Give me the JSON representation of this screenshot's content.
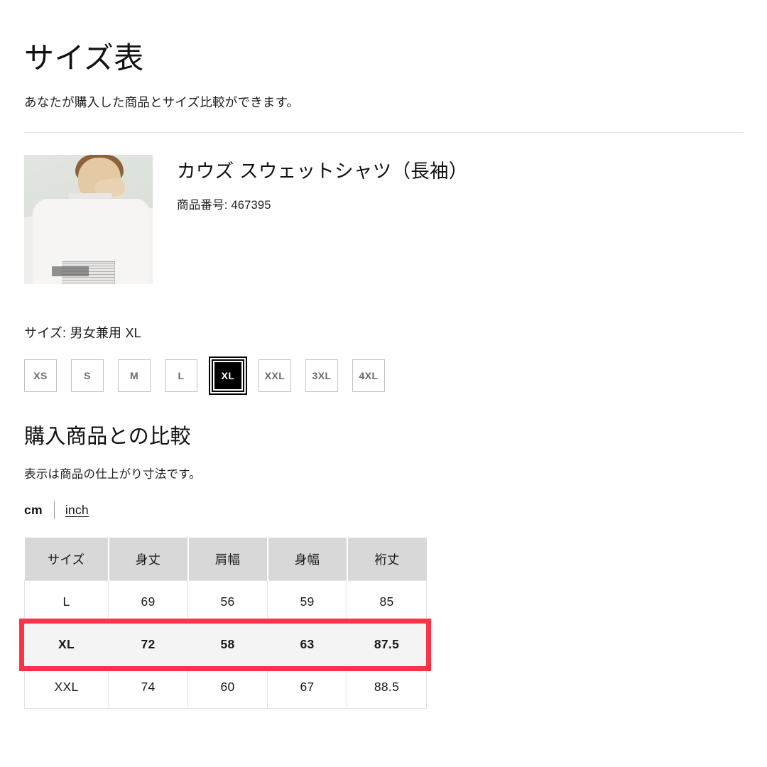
{
  "header": {
    "title": "サイズ表",
    "subtitle": "あなたが購入した商品とサイズ比較ができます。"
  },
  "product": {
    "name": "カウズ スウェットシャツ（長袖）",
    "code_label": "商品番号: 467395",
    "image_alt": "白いスウェットシャツの後ろ姿"
  },
  "size_selector": {
    "label": "サイズ: 男女兼用 XL",
    "selected": "XL",
    "options": [
      "XS",
      "S",
      "M",
      "L",
      "XL",
      "XXL",
      "3XL",
      "4XL"
    ]
  },
  "comparison": {
    "title": "購入商品との比較",
    "note": "表示は商品の仕上がり寸法です。",
    "unit_active": "cm",
    "unit_link": "inch",
    "highlight_color": "#fa3348"
  },
  "table": {
    "columns": [
      "サイズ",
      "身丈",
      "肩幅",
      "身幅",
      "裄丈"
    ],
    "rows": [
      {
        "size": "L",
        "values": [
          "69",
          "56",
          "59",
          "85"
        ],
        "highlighted": false
      },
      {
        "size": "XL",
        "values": [
          "72",
          "58",
          "63",
          "87.5"
        ],
        "highlighted": true
      },
      {
        "size": "XXL",
        "values": [
          "74",
          "60",
          "67",
          "88.5"
        ],
        "highlighted": false
      }
    ]
  }
}
